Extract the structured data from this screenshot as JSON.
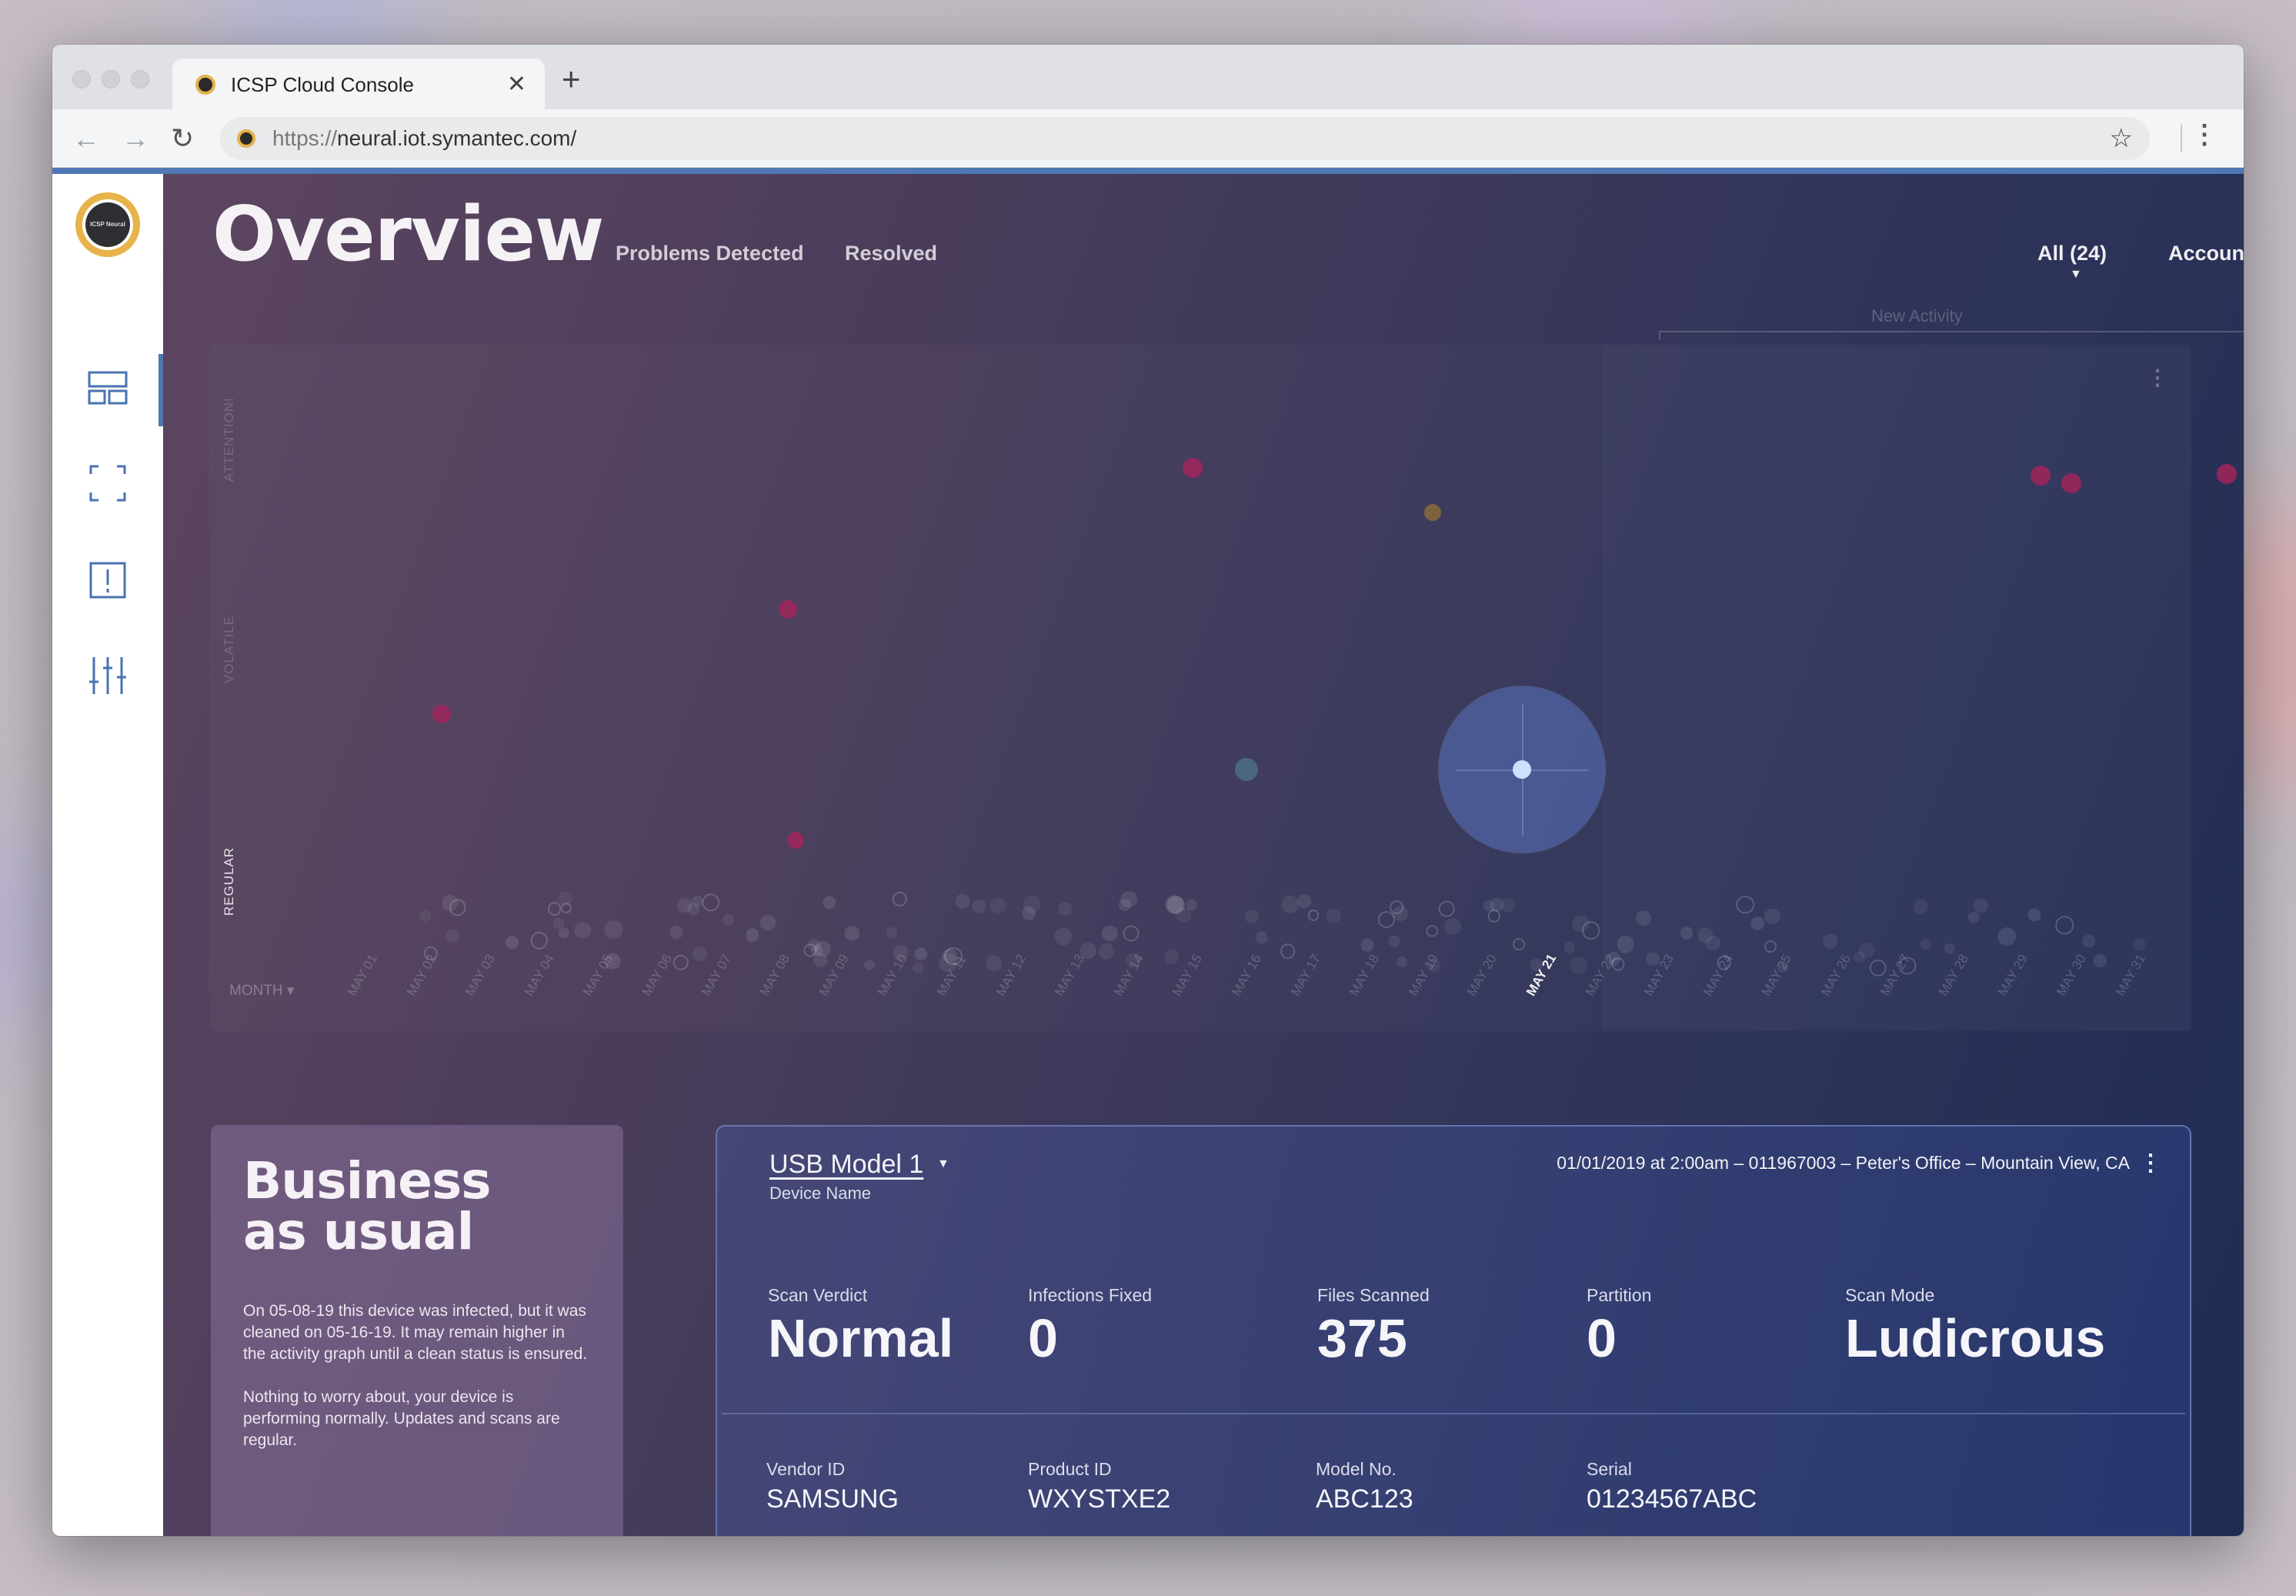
{
  "browser": {
    "tab_title": "ICSP Cloud Console",
    "new_tab": "+",
    "close": "✕",
    "url_scheme": "https://",
    "url_host": "neural.iot.symantec.com/"
  },
  "sidebar": {
    "logo_text": "ICSP Neural",
    "items": [
      {
        "name": "dashboard",
        "icon": "dashboard-icon",
        "active": true
      },
      {
        "name": "scan",
        "icon": "scan-frame-icon",
        "active": false
      },
      {
        "name": "alerts",
        "icon": "alert-icon",
        "active": false
      },
      {
        "name": "settings",
        "icon": "sliders-icon",
        "active": false
      }
    ]
  },
  "header": {
    "title": "Overview",
    "tabs": [
      "Problems Detected",
      "Resolved"
    ],
    "filter": "All (24)",
    "account": "Account"
  },
  "activity": {
    "new_activity_label": "New Activity",
    "month_selector": "MONTH ▾",
    "y_levels": [
      "ATTENTION!",
      "VOLATILE",
      "REGULAR"
    ],
    "active_level": "REGULAR",
    "days": [
      "MAY 01",
      "MAY 02",
      "MAY 03",
      "MAY 04",
      "MAY 05",
      "MAY 06",
      "MAY 07",
      "MAY 08",
      "MAY 09",
      "MAY 10",
      "MAY 11",
      "MAY 12",
      "MAY 13",
      "MAY 14",
      "MAY 15",
      "MAY 16",
      "MAY 17",
      "MAY 18",
      "MAY 19",
      "MAY 20",
      "MAY 21",
      "MAY 22",
      "MAY 23",
      "MAY 24",
      "MAY 25",
      "MAY 26",
      "MAY 27",
      "MAY 28",
      "MAY 29",
      "MAY 30",
      "MAY 31"
    ],
    "selected_day": "MAY 21",
    "colors": {
      "attention": "#a0245a",
      "volatile": "#8a6a3a",
      "regular": "#4d6d85",
      "focus": "#cfe0ff"
    }
  },
  "status": {
    "title_line1": "Business",
    "title_line2": "as usual",
    "para1": "On 05-08-19 this device was infected, but it was cleaned on 05-16-19. It may remain higher in the activity graph until a clean status is ensured.",
    "para2": "Nothing to worry about, your device is performing normally. Updates and scans are regular."
  },
  "device": {
    "name": "USB Model 1",
    "name_caption": "Device  Name",
    "meta": "01/01/2019 at 2:00am – 011967003 – Peter's Office – Mountain View, CA",
    "stats": [
      {
        "label": "Scan Verdict",
        "value": "Normal"
      },
      {
        "label": "Infections Fixed",
        "value": "0"
      },
      {
        "label": "Files Scanned",
        "value": "375"
      },
      {
        "label": "Partition",
        "value": "0"
      },
      {
        "label": "Scan Mode",
        "value": "Ludicrous"
      }
    ],
    "info": [
      {
        "label": "Vendor ID",
        "value": "SAMSUNG"
      },
      {
        "label": "Product  ID",
        "value": "WXYSTXE2"
      },
      {
        "label": "Model No.",
        "value": "ABC123"
      },
      {
        "label": "Serial",
        "value": "01234567ABC"
      }
    ]
  }
}
